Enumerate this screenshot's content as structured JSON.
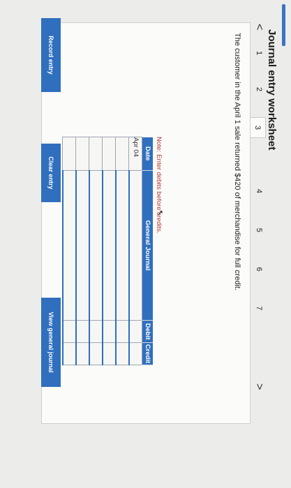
{
  "title": "Journal entry worksheet",
  "steps": {
    "prev_symbol": "<",
    "next_symbol": ">",
    "items": [
      "1",
      "2",
      "3",
      "4",
      "5",
      "6",
      "7"
    ],
    "active": "3"
  },
  "prompt": "The customer in the April 1 sale returned $420 of merchandise for full credit.",
  "note": "Note: Enter debits before credits.",
  "table": {
    "headers": {
      "date": "Date",
      "journal": "General Journal",
      "debit": "Debit",
      "credit": "Credit"
    },
    "rows": [
      {
        "date": "Apr 04",
        "journal": "",
        "debit": "",
        "credit": ""
      },
      {
        "date": "",
        "journal": "",
        "debit": "",
        "credit": ""
      },
      {
        "date": "",
        "journal": "",
        "debit": "",
        "credit": ""
      },
      {
        "date": "",
        "journal": "",
        "debit": "",
        "credit": ""
      },
      {
        "date": "",
        "journal": "",
        "debit": "",
        "credit": ""
      },
      {
        "date": "",
        "journal": "",
        "debit": "",
        "credit": ""
      }
    ]
  },
  "buttons": {
    "record": "Record entry",
    "clear": "Clear entry",
    "view": "View general journal"
  },
  "colors": {
    "accent": "#2f6fbe",
    "note": "#b23a2f",
    "background": "#ececea"
  }
}
